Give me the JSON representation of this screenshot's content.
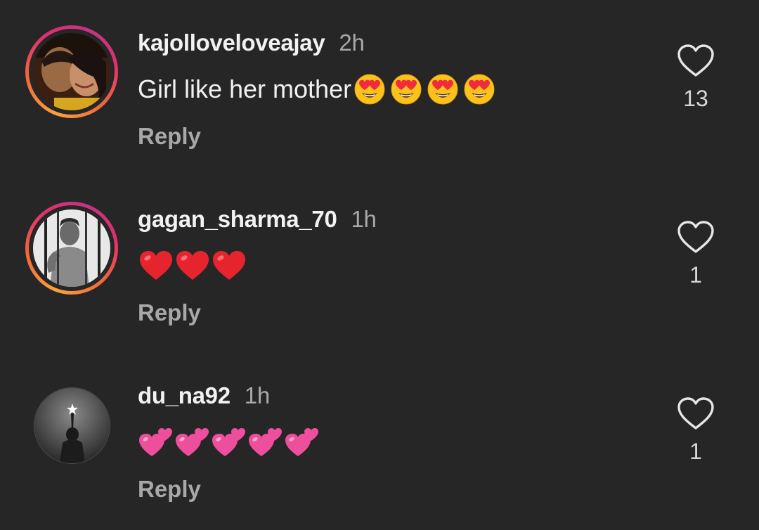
{
  "comments": [
    {
      "username": "kajolloveloveajay",
      "time": "2h",
      "text": "Girl like her mother",
      "emojis": [
        "heart-eyes",
        "heart-eyes",
        "heart-eyes",
        "heart-eyes"
      ],
      "reply_label": "Reply",
      "like_count": "13",
      "avatar": "couple-photo",
      "story_ring": true
    },
    {
      "username": "gagan_sharma_70",
      "time": "1h",
      "text": "",
      "emojis": [
        "red-heart",
        "red-heart",
        "red-heart"
      ],
      "reply_label": "Reply",
      "like_count": "1",
      "avatar": "man-behind-bars-photo",
      "story_ring": true
    },
    {
      "username": "du_na92",
      "time": "1h",
      "text": "",
      "emojis": [
        "two-hearts",
        "two-hearts",
        "two-hearts",
        "two-hearts",
        "two-hearts"
      ],
      "reply_label": "Reply",
      "like_count": "1",
      "avatar": "person-with-star-photo",
      "story_ring": false
    }
  ],
  "colors": {
    "background": "#262627",
    "primary_text": "#f2f2f2",
    "secondary_text": "#a8a8a8"
  }
}
